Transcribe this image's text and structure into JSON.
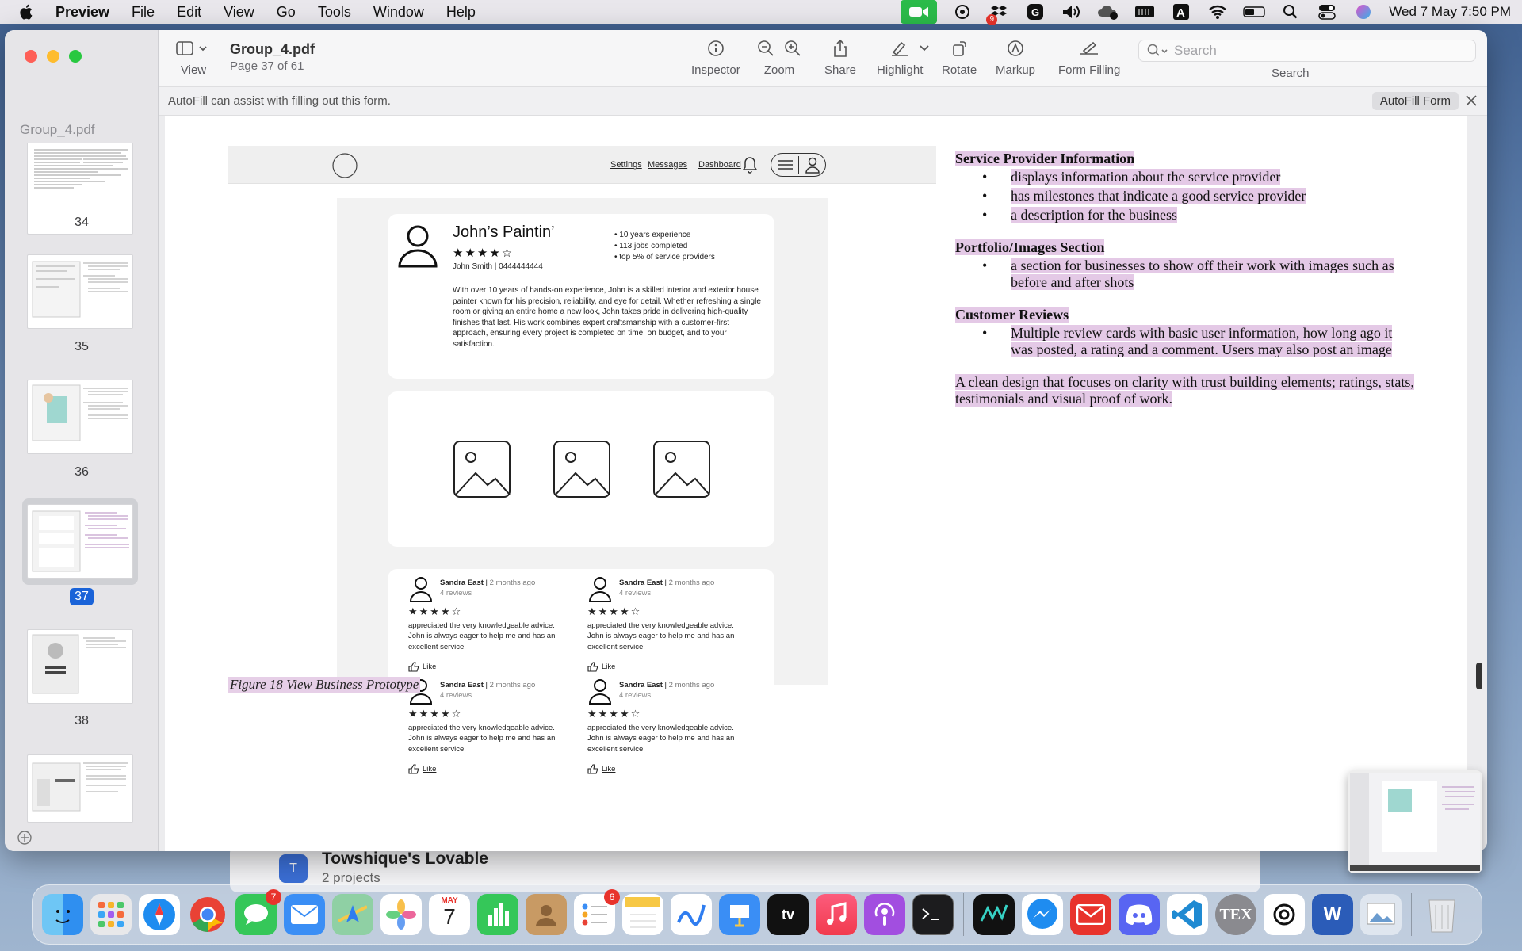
{
  "menubar": {
    "app": "Preview",
    "menus": [
      "File",
      "Edit",
      "View",
      "Go",
      "Tools",
      "Window",
      "Help"
    ],
    "clock": "Wed 7 May  7:50 PM",
    "dropbox_badge": "9"
  },
  "window": {
    "doc_title": "Group_4.pdf",
    "doc_subtitle": "Page 37 of 61",
    "view_label": "View",
    "toolbar": {
      "inspector": "Inspector",
      "zoom": "Zoom",
      "share": "Share",
      "highlight": "Highlight",
      "rotate": "Rotate",
      "markup": "Markup",
      "form_filling": "Form Filling",
      "search_placeholder": "Search",
      "search_label": "Search"
    },
    "autofill": {
      "text": "AutoFill can assist with filling out this form.",
      "button": "AutoFill Form"
    }
  },
  "sidebar": {
    "title": "Group_4.pdf",
    "pages": [
      "34",
      "35",
      "36",
      "37",
      "38"
    ],
    "selected_page": "37"
  },
  "prototype": {
    "nav": [
      "Settings",
      "Messages",
      "Dashboard"
    ],
    "business_name": "John’s Paintin’",
    "stars": "★★★★☆",
    "owner_line": "John Smith | 0444444444",
    "stats": [
      "10 years experience",
      "113 jobs completed",
      "top 5% of service providers"
    ],
    "description": "With over 10 years of hands-on experience, John is a skilled interior and exterior house painter known for his precision, reliability, and eye for detail. Whether refreshing a single room or giving an entire home a new look, John takes pride in delivering high-quality finishes that last. His work combines expert craftsmanship with a customer-first approach, ensuring every project is completed on time, on budget, and to your satisfaction.",
    "reviews": [
      {
        "name": "Sandra East",
        "ago": "2 months ago",
        "count": "4 reviews",
        "stars": "★★★★☆",
        "text": "appreciated the very knowledgeable advice. John is always eager to help me and has an excellent service!",
        "like": "Like"
      },
      {
        "name": "Sandra East",
        "ago": "2 months ago",
        "count": "4 reviews",
        "stars": "★★★★☆",
        "text": "appreciated the very knowledgeable advice. John is always eager to help me and has an excellent service!",
        "like": "Like"
      },
      {
        "name": "Sandra East",
        "ago": "2 months ago",
        "count": "4 reviews",
        "stars": "★★★★☆",
        "text": "appreciated the very knowledgeable advice. John is always eager to help me and has an excellent service!",
        "like": "Like"
      },
      {
        "name": "Sandra East",
        "ago": "2 months ago",
        "count": "4 reviews",
        "stars": "★★★★☆",
        "text": "appreciated the very knowledgeable advice. John is always eager to help me and has an excellent service!",
        "like": "Like"
      }
    ],
    "caption": "Figure 18 View Business Prototype"
  },
  "notes": {
    "sections": [
      {
        "heading": "Service Provider Information",
        "bullets": [
          "displays information about the service provider",
          "has milestones that indicate a good service provider",
          "a description for the business"
        ]
      },
      {
        "heading": "Portfolio/Images Section",
        "bullets": [
          "a section for businesses to show off their work with images such as before and after shots"
        ]
      },
      {
        "heading": "Customer Reviews",
        "bullets": [
          "Multiple review cards with basic user information, how long ago it was posted, a rating and a comment. Users may also post an image"
        ]
      }
    ],
    "summary": "A clean design that focuses on clarity with trust building elements; ratings, stats, testimonials and visual proof of work."
  },
  "background_window": {
    "title": "Towshique's Lovable",
    "subtitle": "2 projects",
    "avatar": "T"
  },
  "dock": {
    "calendar_month": "MAY",
    "calendar_day": "7",
    "messages_badge": "7",
    "reminders_badge": "6"
  },
  "colors": {
    "highlight": "#e4c9e6",
    "selection": "#1a63d8"
  }
}
